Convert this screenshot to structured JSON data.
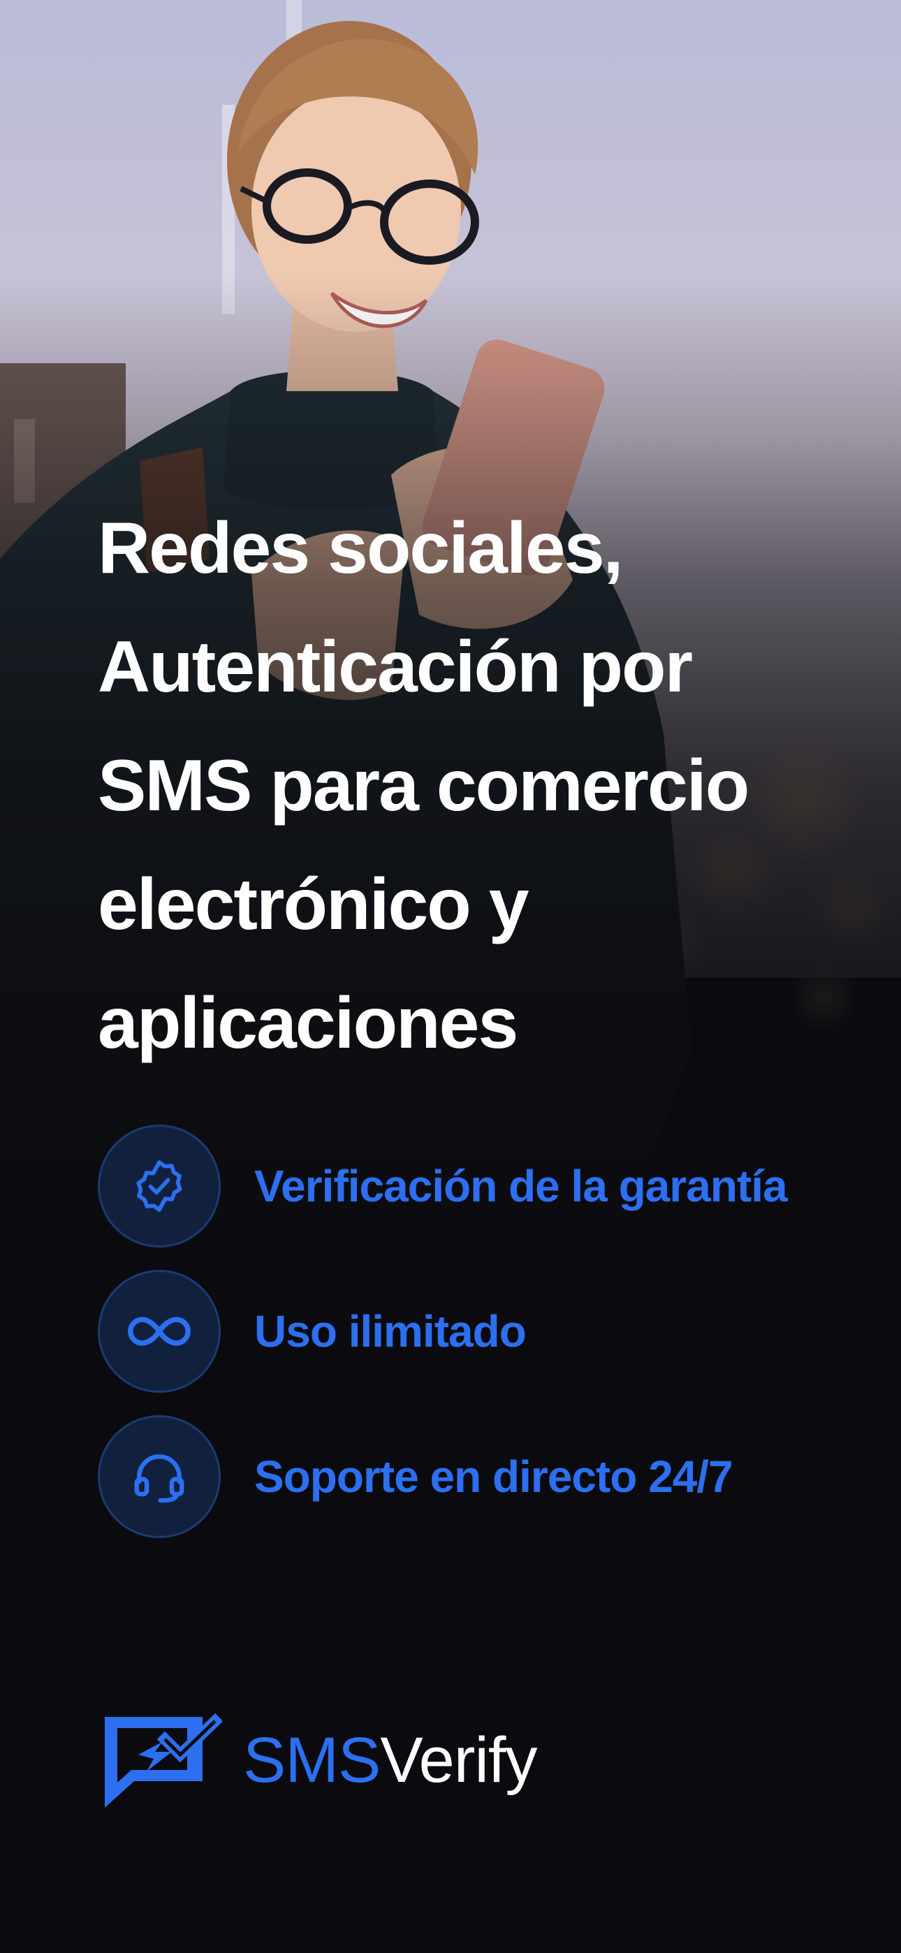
{
  "hero": {
    "headline_lines": [
      "Redes sociales,",
      "Autenticación por",
      "SMS para comercio",
      "electrónico y",
      "aplicaciones"
    ]
  },
  "features": [
    {
      "icon": "verified-badge-icon",
      "label": "Verificación de la garantía"
    },
    {
      "icon": "infinity-icon",
      "label": "Uso ilimitado"
    },
    {
      "icon": "headset-icon",
      "label": "Soporte en directo 24/7"
    }
  ],
  "brand": {
    "name_part1": "SMS",
    "name_part2": "Verify",
    "icon": "chat-check-logo-icon"
  },
  "colors": {
    "accent": "#2c6ff0",
    "background": "#0b0b0f",
    "icon_circle": "#11203d",
    "headline": "#ffffff"
  }
}
